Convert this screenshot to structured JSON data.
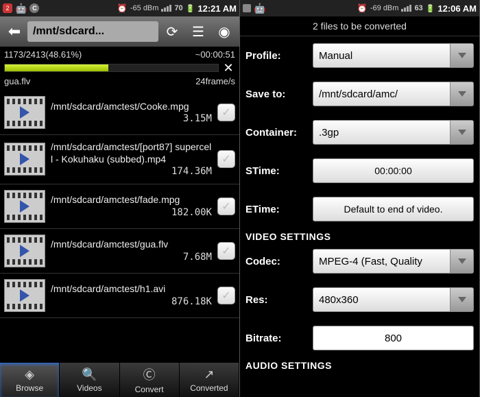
{
  "left": {
    "statusbar": {
      "badge": "2",
      "signal": "-65 dBm",
      "battery": "70",
      "time": "12:21 AM"
    },
    "topbar": {
      "path": "/mnt/sdcard..."
    },
    "progress": {
      "counter": "1173/2413(48.61%)",
      "time": "~00:00:51",
      "percent": 49,
      "file": "gua.flv",
      "rate": "24frame/s"
    },
    "files": [
      {
        "path": "/mnt/sdcard/amctest/Cooke.mpg",
        "size": "3.15M"
      },
      {
        "path": "/mnt/sdcard/amctest/[port87] supercell - Kokuhaku (subbed).mp4",
        "size": "174.36M"
      },
      {
        "path": "/mnt/sdcard/amctest/fade.mpg",
        "size": "182.00K"
      },
      {
        "path": "/mnt/sdcard/amctest/gua.flv",
        "size": "7.68M"
      },
      {
        "path": "/mnt/sdcard/amctest/h1.avi",
        "size": "876.18K"
      }
    ],
    "tabs": [
      {
        "label": "Browse"
      },
      {
        "label": "Videos"
      },
      {
        "label": "Convert"
      },
      {
        "label": "Converted"
      }
    ]
  },
  "right": {
    "statusbar": {
      "signal": "-69 dBm",
      "battery": "63",
      "time": "12:06 AM"
    },
    "header": "2  files to be converted",
    "form": {
      "profile": {
        "label": "Profile:",
        "value": "Manual"
      },
      "saveto": {
        "label": "Save to:",
        "value": "/mnt/sdcard/amc/"
      },
      "container": {
        "label": "Container:",
        "value": ".3gp"
      },
      "stime": {
        "label": "STime:",
        "value": "00:00:00"
      },
      "etime": {
        "label": "ETime:",
        "value": "Default to end of video."
      },
      "video_hdr": "VIDEO SETTINGS",
      "codec": {
        "label": "Codec:",
        "value": "MPEG-4 (Fast, Quality"
      },
      "res": {
        "label": "Res:",
        "value": "480x360"
      },
      "bitrate": {
        "label": "Bitrate:",
        "value": "800"
      },
      "audio_hdr": "AUDIO SETTINGS"
    }
  }
}
